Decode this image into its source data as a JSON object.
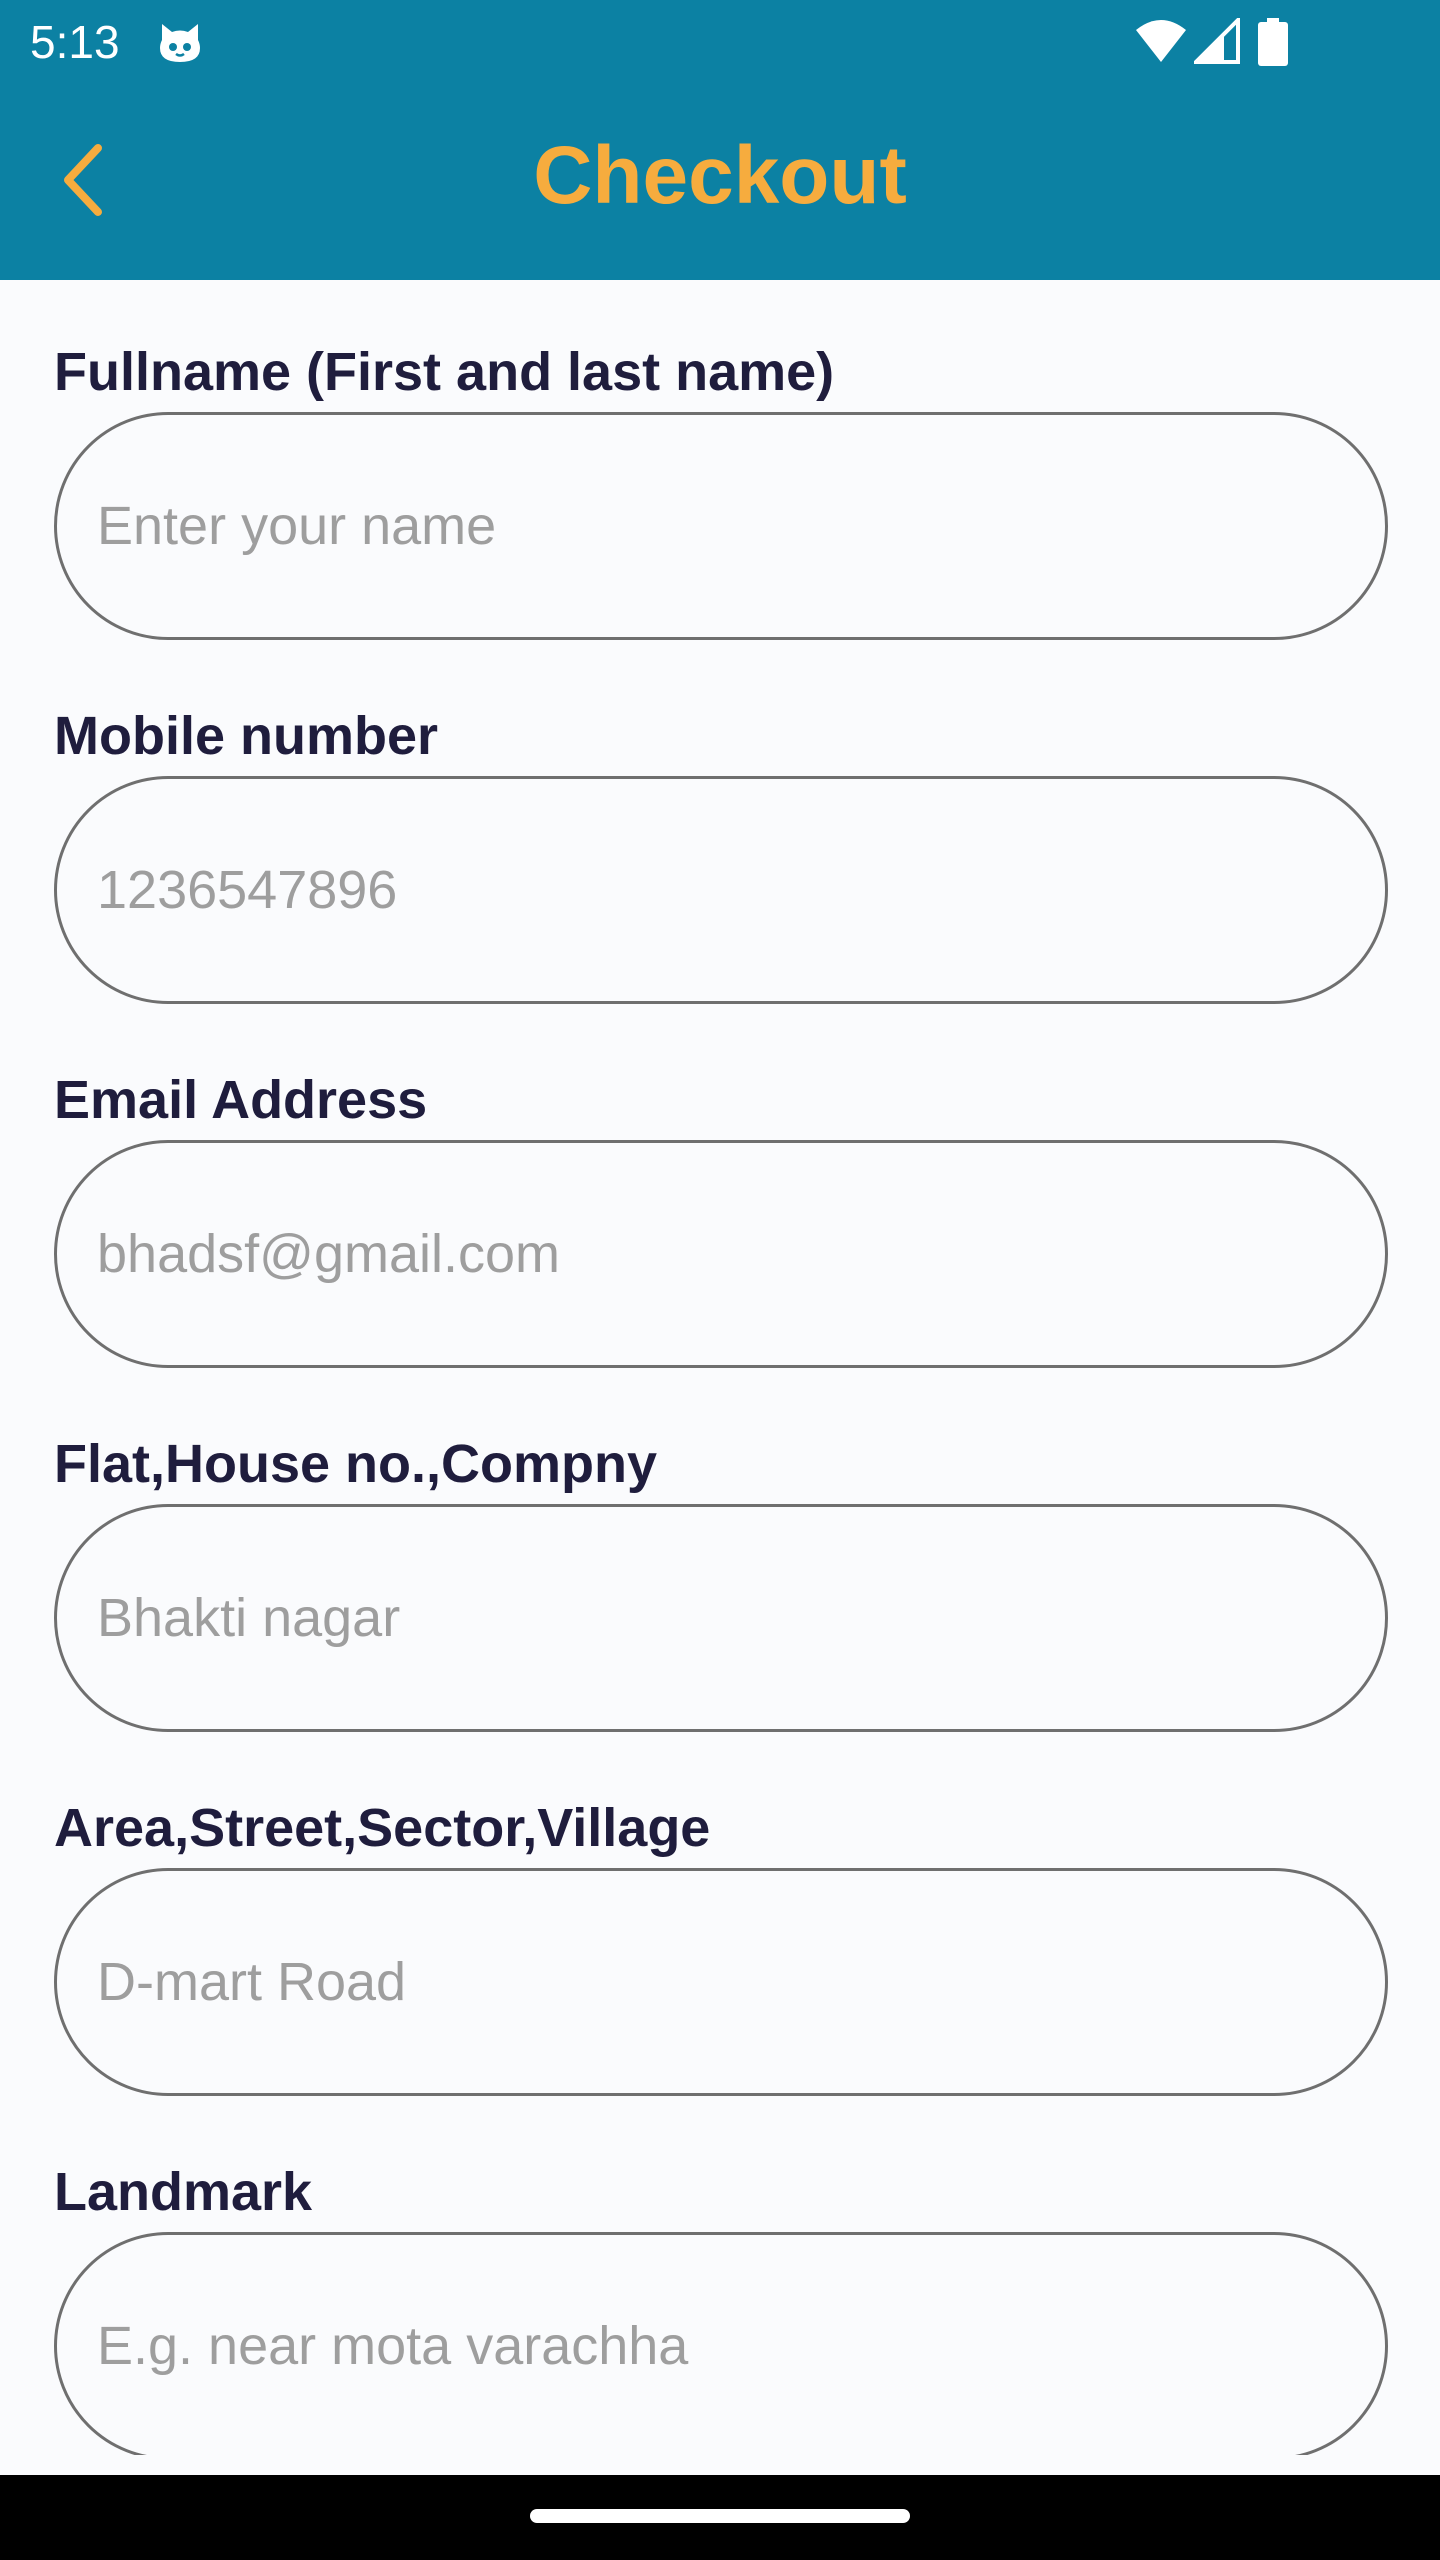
{
  "status_bar": {
    "time": "5:13",
    "app_icon": "cat-face-icon",
    "wifi_icon": "wifi-icon",
    "signal_icon": "cellular-signal-icon",
    "battery_icon": "battery-icon"
  },
  "app_bar": {
    "title": "Checkout",
    "back_icon": "chevron-left-icon",
    "background_color": "#0c81a3",
    "title_color": "#f6ac3e"
  },
  "form": {
    "fields": [
      {
        "label": "Fullname (First and last name)",
        "placeholder": "Enter your name",
        "value": ""
      },
      {
        "label": "Mobile number",
        "placeholder": "1236547896",
        "value": ""
      },
      {
        "label": "Email Address",
        "placeholder": "bhadsf@gmail.com",
        "value": ""
      },
      {
        "label": "Flat,House no.,Compny",
        "placeholder": "Bhakti nagar",
        "value": ""
      },
      {
        "label": "Area,Street,Sector,Village",
        "placeholder": "D-mart Road",
        "value": ""
      },
      {
        "label": "Landmark",
        "placeholder": "E.g. near mota varachha",
        "value": ""
      }
    ]
  },
  "nav_bar": {
    "home_handle": "home-gesture-handle"
  }
}
